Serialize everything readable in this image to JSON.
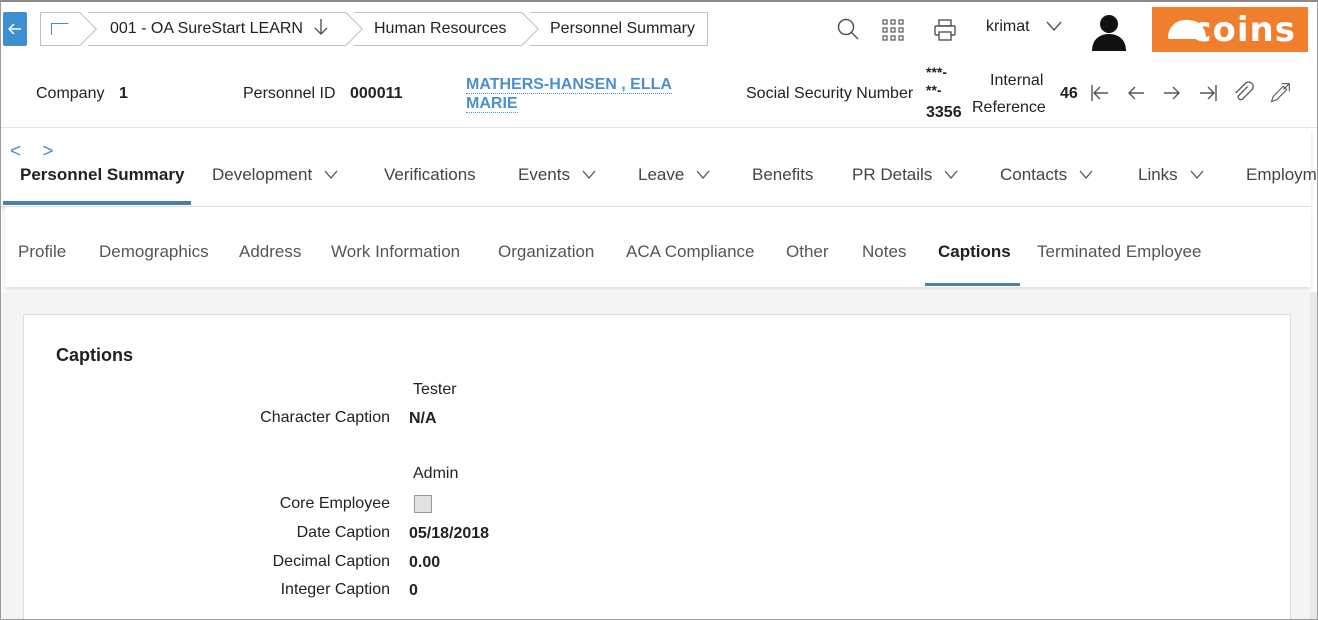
{
  "topbar": {
    "breadcrumbs": [
      "001 - OA SureStart LEARN",
      "Human Resources",
      "Personnel Summary"
    ],
    "user": "krimat",
    "logo_text": "coins",
    "accent": "#3d8fd1",
    "logo_color": "#f07e2d"
  },
  "header": {
    "company_label": "Company",
    "company_value": "1",
    "personnel_id_label": "Personnel ID",
    "personnel_id_value": "000011",
    "employee_name_line1": "MATHERS-HANSEN , ELLA",
    "employee_name_line2": "MARIE",
    "ssn_label": "Social Security Number",
    "ssn_line1": "***-",
    "ssn_line2": "**-",
    "ssn_line3": "3356",
    "internal_label_line1": "Internal",
    "internal_label_line2": "Reference",
    "internal_value": "46"
  },
  "tabs_primary": {
    "scroll": "< >",
    "items": [
      {
        "label": "Personnel Summary",
        "dropdown": false
      },
      {
        "label": "Development",
        "dropdown": true
      },
      {
        "label": "Verifications",
        "dropdown": false
      },
      {
        "label": "Events",
        "dropdown": true
      },
      {
        "label": "Leave",
        "dropdown": true
      },
      {
        "label": "Benefits",
        "dropdown": false
      },
      {
        "label": "PR Details",
        "dropdown": true
      },
      {
        "label": "Contacts",
        "dropdown": true
      },
      {
        "label": "Links",
        "dropdown": true
      },
      {
        "label": "Employm",
        "dropdown": false
      }
    ]
  },
  "tabs_secondary": {
    "items": [
      "Profile",
      "Demographics",
      "Address",
      "Work Information",
      "Organization",
      "ACA Compliance",
      "Other",
      "Notes",
      "Captions",
      "Terminated Employee"
    ]
  },
  "captions": {
    "title": "Captions",
    "group1_heading": "Tester",
    "character_caption_label": "Character Caption",
    "character_caption_value": "N/A",
    "group2_heading": "Admin",
    "core_employee_label": "Core Employee",
    "core_employee_checked": false,
    "date_caption_label": "Date Caption",
    "date_caption_value": "05/18/2018",
    "decimal_caption_label": "Decimal Caption",
    "decimal_caption_value": "0.00",
    "integer_caption_label": "Integer Caption",
    "integer_caption_value": "0"
  }
}
